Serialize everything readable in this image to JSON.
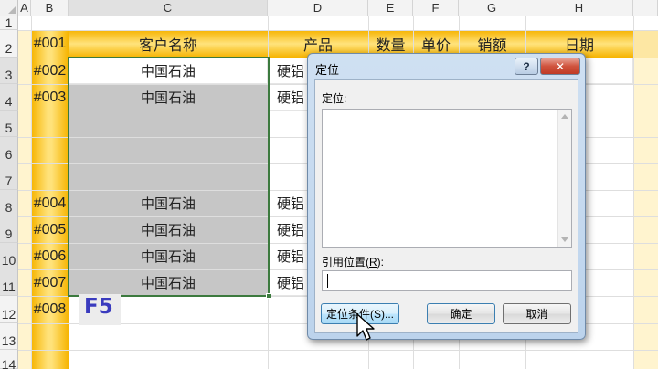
{
  "columns": [
    "A",
    "B",
    "C",
    "D",
    "E",
    "F",
    "G",
    "H"
  ],
  "rows": [
    "1",
    "2",
    "3",
    "4",
    "5",
    "6",
    "7",
    "8",
    "9",
    "10",
    "11",
    "12",
    "13",
    "14"
  ],
  "table_headers": {
    "customer": "客户名称",
    "product": "产品",
    "qty": "数量",
    "price": "单价",
    "sales": "销额",
    "date": "日期"
  },
  "ids": [
    "#001",
    "#002",
    "#003",
    "#004",
    "#005",
    "#006",
    "#007",
    "#008"
  ],
  "customers": {
    "r3": "中国石油",
    "r4": "中国石油",
    "r8": "中国石油",
    "r9": "中国石油",
    "r10": "中国石油",
    "r11": "中国石油"
  },
  "products_partial": [
    "硬铝",
    "硬铝",
    "硬铝",
    "硬铝",
    "硬铝",
    "硬铝"
  ],
  "keyboard_hint": "F5",
  "dialog": {
    "title": "定位",
    "help": "?",
    "close": "✕",
    "goto_label": "定位:",
    "reference_label_prefix": "引用位置(",
    "reference_label_key": "R",
    "reference_label_suffix": "):",
    "reference_value": "",
    "special_button": "定位条件(S)...",
    "ok_button": "确定",
    "cancel_button": "取消"
  },
  "colors": {
    "header_gold": "#f6b300",
    "selection_border": "#3c7a3e",
    "selected_fill": "#c6c6c6",
    "hint_text": "#3a3bbe"
  }
}
